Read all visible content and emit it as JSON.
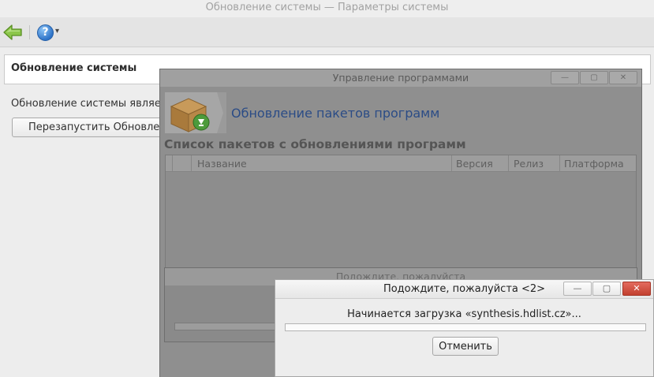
{
  "main_window": {
    "title": "Обновление системы — Параметры системы"
  },
  "toolbar": {
    "back_icon": "back-arrow-icon",
    "help_icon": "help-icon",
    "help_glyph": "?",
    "dropdown_glyph": "▾"
  },
  "content": {
    "header_title": "Обновление системы",
    "body_text": "Обновление системы является",
    "restart_button": "Перезапустить Обновление"
  },
  "manager_window": {
    "title": "Управление программами",
    "minimize_glyph": "—",
    "maximize_glyph": "▢",
    "close_glyph": "✕",
    "heading": "Обновление пакетов программ",
    "list_title": "Список пакетов с обновлениями программ",
    "columns": [
      "Название",
      "Версия",
      "Релиз",
      "Платформа"
    ]
  },
  "wait_dialog_1": {
    "title": "Подождите, пожалуйста"
  },
  "wait_dialog_2": {
    "title": "Подождите, пожалуйста <2>",
    "minimize_glyph": "—",
    "maximize_glyph": "▢",
    "close_glyph": "✕",
    "message": "Начинается загрузка «synthesis.hdlist.cz»...",
    "progress": 0,
    "cancel_button": "Отменить"
  },
  "colors": {
    "accent_blue": "#2b4c86",
    "close_red": "#c2402f",
    "back_green": "#7fc040"
  }
}
